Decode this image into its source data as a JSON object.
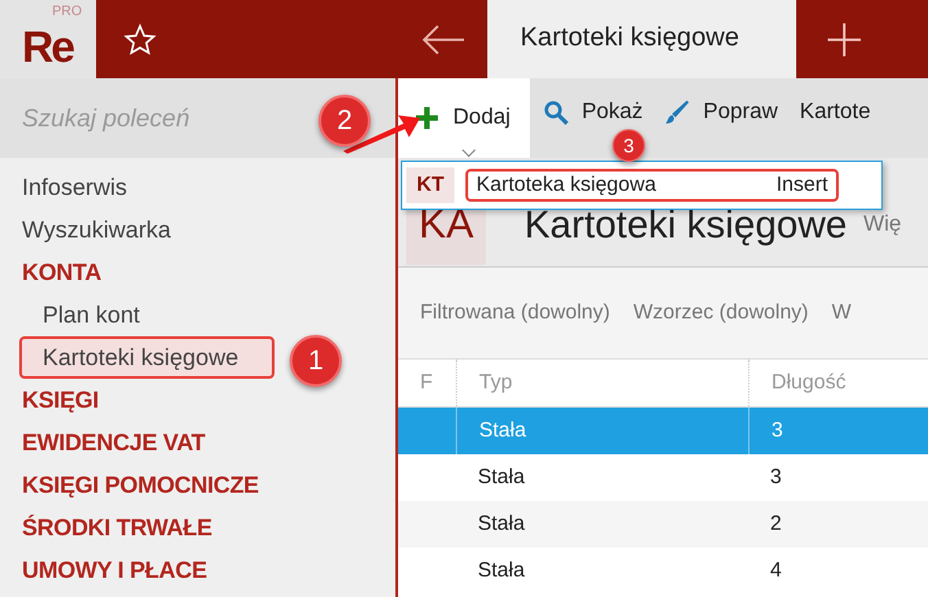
{
  "logo": {
    "text": "Re",
    "badge": "PRO"
  },
  "tabs": [
    {
      "label": "Kartoteki księgowe",
      "selected": true
    }
  ],
  "search": {
    "placeholder": "Szukaj poleceń"
  },
  "sidebar": {
    "items": [
      {
        "label": "Infoserwis",
        "kind": "link",
        "selected": false
      },
      {
        "label": "Wyszukiwarka",
        "kind": "link",
        "selected": false
      },
      {
        "label": "KONTA",
        "kind": "section",
        "selected": false,
        "children": [
          {
            "label": "Plan kont",
            "kind": "link",
            "selected": false
          },
          {
            "label": "Kartoteki księgowe",
            "kind": "link",
            "selected": true
          }
        ]
      },
      {
        "label": "KSIĘGI",
        "kind": "section",
        "selected": false
      },
      {
        "label": "EWIDENCJE VAT",
        "kind": "section",
        "selected": false
      },
      {
        "label": "KSIĘGI POMOCNICZE",
        "kind": "section",
        "selected": false
      },
      {
        "label": "ŚRODKI TRWAŁE",
        "kind": "section",
        "selected": false
      },
      {
        "label": "UMOWY I PŁACE",
        "kind": "section",
        "selected": false
      }
    ]
  },
  "toolbar": [
    {
      "label": "Dodaj",
      "kind": "plus",
      "selected": true
    },
    {
      "label": "Pokaż",
      "kind": "search",
      "selected": false
    },
    {
      "label": "Popraw",
      "kind": "brush",
      "selected": false
    },
    {
      "label": "Kartote",
      "kind": "text",
      "selected": false
    }
  ],
  "dropdown": {
    "items": [
      {
        "code": "KT",
        "label": "Kartoteka księgowa",
        "shortcut": "Insert"
      }
    ]
  },
  "header": {
    "code": "KA",
    "title": "Kartoteki księgowe",
    "more": "Wię"
  },
  "filters": [
    "Filtrowana (dowolny)",
    "Wzorzec (dowolny)",
    "W"
  ],
  "table": {
    "columns": [
      "F",
      "Typ",
      "Długość"
    ],
    "rows": [
      {
        "cells": [
          "",
          "Stała",
          "3"
        ],
        "selected": true
      },
      {
        "cells": [
          "",
          "Stała",
          "3"
        ],
        "selected": false
      },
      {
        "cells": [
          "",
          "Stała",
          "2"
        ],
        "selected": false
      },
      {
        "cells": [
          "",
          "Stała",
          "4"
        ],
        "selected": false
      }
    ]
  },
  "annotations": [
    {
      "label": "1"
    },
    {
      "label": "2"
    },
    {
      "label": "3"
    }
  ]
}
